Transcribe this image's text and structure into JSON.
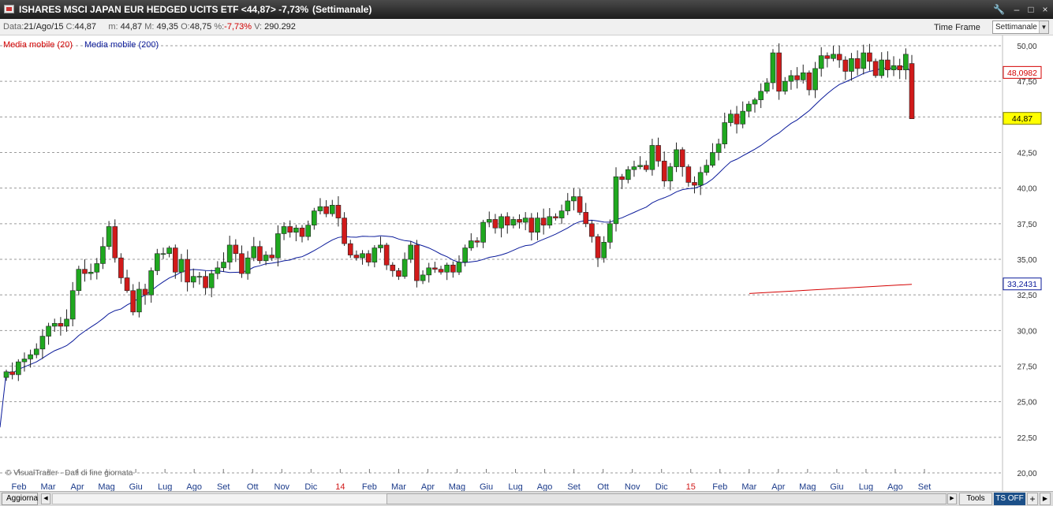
{
  "window": {
    "title": "ISHARES MSCI JAPAN EUR HEDGED UCITS ETF <44,87> -7,73%",
    "period": "(Settimanale)",
    "buttons": {
      "tools_icon": "wrench-icon",
      "min": "‒",
      "restore": "□",
      "close": "×"
    }
  },
  "infobar": {
    "date_label": "Data:",
    "date": "21/Ago/15",
    "close_label": "C:",
    "close": "44,87",
    "min_label": "m:",
    "min": "44,87",
    "max_label": "M:",
    "max": "49,35",
    "open_label": "O:",
    "open": "48,75",
    "pct_label": "%:",
    "pct": "-7,73%",
    "vol_label": "V:",
    "vol": "290.292",
    "timeframe_label": "Time Frame",
    "timeframe_value": "Settimanale"
  },
  "colors": {
    "up": "#1fa81f",
    "down": "#d11a1a",
    "ma20": "#d40000",
    "ma200": "#0a1a9a",
    "grid": "#9a9a9a",
    "last_price_bg": "#ffff00"
  },
  "bottombar": {
    "refresh": "Aggiorna",
    "tools": "Tools",
    "ts": "TS OFF",
    "plus": "+"
  },
  "chart_data": {
    "type": "candlestick",
    "legend": [
      "Media mobile (20)",
      "Media mobile (200)"
    ],
    "watermark": "© VisualTrader - Dati di fine giornata",
    "ylim": [
      20,
      50
    ],
    "yticks": [
      "20,00",
      "22,50",
      "25,00",
      "27,50",
      "30,00",
      "32,50",
      "35,00",
      "37,50",
      "40,00",
      "42,50",
      "45,00",
      "47,50",
      "50,00"
    ],
    "xticks": [
      "Feb",
      "Mar",
      "Apr",
      "Mag",
      "Giu",
      "Lug",
      "Ago",
      "Set",
      "Ott",
      "Nov",
      "Dic",
      "14",
      "Feb",
      "Mar",
      "Apr",
      "Mag",
      "Giu",
      "Lug",
      "Ago",
      "Set",
      "Ott",
      "Nov",
      "Dic",
      "15",
      "Feb",
      "Mar",
      "Apr",
      "Mag",
      "Giu",
      "Lug",
      "Ago",
      "Set"
    ],
    "price_labels": [
      {
        "value": 48.0982,
        "text": "48,0982",
        "series": "ma20"
      },
      {
        "value": 44.87,
        "text": "44,87",
        "series": "last"
      },
      {
        "value": 33.2431,
        "text": "33,2431",
        "series": "ma200"
      }
    ],
    "close": [
      27.1,
      26.9,
      27.8,
      28.0,
      28.3,
      28.7,
      29.6,
      30.3,
      30.5,
      30.3,
      30.8,
      32.8,
      34.3,
      34.0,
      34.1,
      34.7,
      35.9,
      37.3,
      35.1,
      33.7,
      32.8,
      31.3,
      32.9,
      32.5,
      34.2,
      35.4,
      35.4,
      35.8,
      34.1,
      35.0,
      33.4,
      33.8,
      33.8,
      33.0,
      34.0,
      34.4,
      34.8,
      36.0,
      35.4,
      34.0,
      35.1,
      35.9,
      34.9,
      35.3,
      35.1,
      36.8,
      37.3,
      36.9,
      37.2,
      36.6,
      37.4,
      38.4,
      38.7,
      38.2,
      38.8,
      37.9,
      36.1,
      35.3,
      35.1,
      35.4,
      34.8,
      35.8,
      36.0,
      34.6,
      34.2,
      33.8,
      35.0,
      36.0,
      33.5,
      33.9,
      34.4,
      34.3,
      34.1,
      34.6,
      34.1,
      34.8,
      35.8,
      36.3,
      36.2,
      37.6,
      37.8,
      37.2,
      38.0,
      37.4,
      37.8,
      37.6,
      37.9,
      36.9,
      37.9,
      37.4,
      38.0,
      37.9,
      38.4,
      39.1,
      39.4,
      38.3,
      37.5,
      36.6,
      35.1,
      36.2,
      37.5,
      40.8,
      40.6,
      41.3,
      41.5,
      41.6,
      41.3,
      43.0,
      41.9,
      40.5,
      41.5,
      42.7,
      41.5,
      40.4,
      40.2,
      41.1,
      41.6,
      42.5,
      43.1,
      44.6,
      45.2,
      44.5,
      45.4,
      45.9,
      46.2,
      46.8,
      47.4,
      49.5,
      46.8,
      47.5,
      47.9,
      47.6,
      48.1,
      46.9,
      48.4,
      49.3,
      49.1,
      49.4,
      49.0,
      48.2,
      49.1,
      48.4,
      49.5,
      48.9,
      47.9,
      49.0,
      48.3,
      48.6,
      48.3,
      49.4,
      44.87
    ],
    "ma20": [],
    "ma200_range": [
      32.6,
      33.2431
    ]
  }
}
